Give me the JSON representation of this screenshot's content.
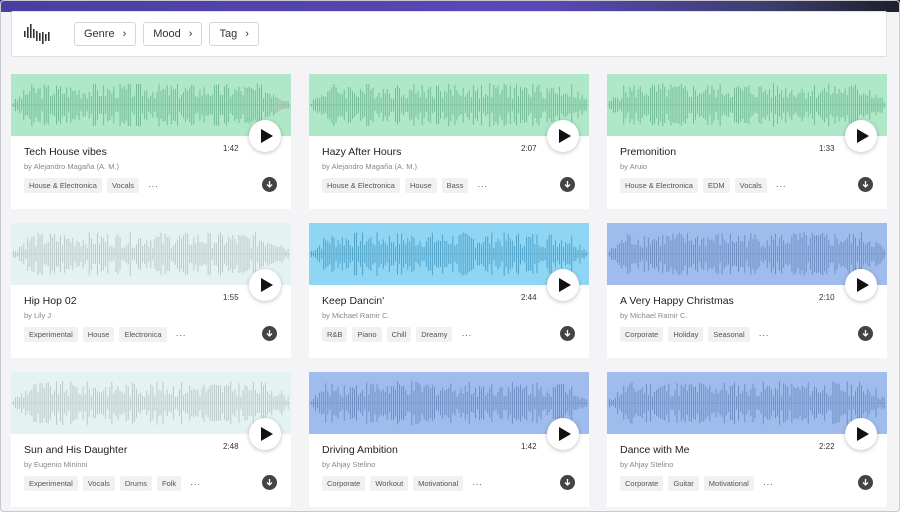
{
  "header": {
    "logo_icon": "waveform-logo-icon",
    "filters": [
      {
        "label": "Genre",
        "icon": "chevron-right-icon"
      },
      {
        "label": "Mood",
        "icon": "chevron-right-icon"
      },
      {
        "label": "Tag",
        "icon": "chevron-right-icon"
      }
    ]
  },
  "tracks": [
    {
      "title": "Tech House vibes",
      "artist": "by Alejandro Magaña (A. M.)",
      "duration": "1:42",
      "tags": [
        "House & Electronica",
        "Vocals"
      ],
      "more": "···",
      "wave_bg": "#aee8c8",
      "wave_fg": "#6fb894",
      "played": 0.95
    },
    {
      "title": "Hazy After Hours",
      "artist": "by Alejandro Magaña (A. M.)",
      "duration": "2:07",
      "tags": [
        "House & Electronica",
        "House",
        "Bass"
      ],
      "more": "···",
      "wave_bg": "#aee8c8",
      "wave_fg": "#6fb894",
      "played": 1
    },
    {
      "title": "Premonition",
      "artist": "by Aruio",
      "duration": "1:33",
      "tags": [
        "House & Electronica",
        "EDM",
        "Vocals"
      ],
      "more": "···",
      "wave_bg": "#aee8c8",
      "wave_fg": "#6fb894",
      "played": 1
    },
    {
      "title": "Hip Hop 02",
      "artist": "by Lily J",
      "duration": "1:55",
      "tags": [
        "Experimental",
        "House",
        "Electronica"
      ],
      "more": "···",
      "wave_bg": "#e5f2f2",
      "wave_fg": "#b9c6c6",
      "played": 1
    },
    {
      "title": "Keep Dancin'",
      "artist": "by Michael Ramir C.",
      "duration": "2:44",
      "tags": [
        "R&B",
        "Piano",
        "Chill",
        "Dreamy"
      ],
      "more": "···",
      "wave_bg": "#8fd6f5",
      "wave_fg": "#4c9ec4",
      "played": 1
    },
    {
      "title": "A Very Happy Christmas",
      "artist": "by Michael Ramir C.",
      "duration": "2:10",
      "tags": [
        "Corporate",
        "Holiday",
        "Seasonal"
      ],
      "more": "···",
      "wave_bg": "#9fbcec",
      "wave_fg": "#6c8bc0",
      "played": 1
    },
    {
      "title": "Sun and His Daughter",
      "artist": "by Eugenio Mininni",
      "duration": "2:48",
      "tags": [
        "Experimental",
        "Vocals",
        "Drums",
        "Folk"
      ],
      "more": "···",
      "wave_bg": "#e5f2f2",
      "wave_fg": "#b9c6c6",
      "played": 1
    },
    {
      "title": "Driving Ambition",
      "artist": "by Ahjay Stelino",
      "duration": "1:42",
      "tags": [
        "Corporate",
        "Workout",
        "Motivational"
      ],
      "more": "···",
      "wave_bg": "#9fbcec",
      "wave_fg": "#6c8bc0",
      "played": 1
    },
    {
      "title": "Dance with Me",
      "artist": "by Ahjay Stelino",
      "duration": "2:22",
      "tags": [
        "Corporate",
        "Guitar",
        "Motivational"
      ],
      "more": "···",
      "wave_bg": "#9fbcec",
      "wave_fg": "#6c8bc0",
      "played": 1
    }
  ],
  "icons": {
    "play": "play-icon",
    "download": "download-icon"
  }
}
